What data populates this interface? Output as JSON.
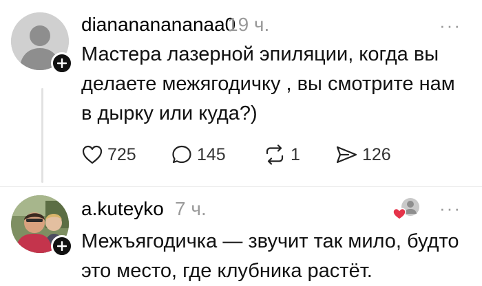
{
  "posts": [
    {
      "username": "dianananananaa0",
      "time": "19 ч.",
      "text": "Мастера лазерной эпиляции, когда вы делаете межягодичку , вы смотрите нам в дырку или куда?)",
      "actions": {
        "likes": "725",
        "replies": "145",
        "reposts": "1",
        "shares": "126"
      }
    },
    {
      "username": "a.kuteyko",
      "time": "7 ч.",
      "text": "Межъягодичка — звучит так мило, будто это место, где клубника растёт."
    }
  ],
  "more_label": "···",
  "icons": {
    "avatar": "default-user-avatar",
    "follow": "plus-icon",
    "like": "heart-icon",
    "reply": "comment-bubble-icon",
    "repost": "repost-icon",
    "share": "send-icon",
    "liked_by_author": "heart-avatar-badge-icon"
  },
  "colors": {
    "like_badge": "#e5344a",
    "muted_text": "#9a9a9a"
  }
}
